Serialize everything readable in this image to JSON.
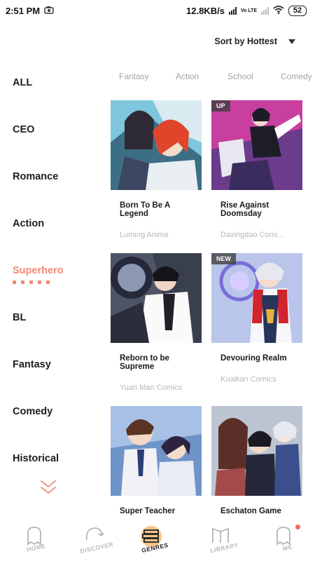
{
  "status_bar": {
    "time": "2:51 PM",
    "speed": "12.8KB/s",
    "network_tag": "Vo LTE",
    "battery": "52"
  },
  "sort": {
    "label": "Sort by Hottest",
    "icon": "dropdown-triangle-icon"
  },
  "genres": [
    {
      "label": "ALL"
    },
    {
      "label": "CEO"
    },
    {
      "label": "Romance"
    },
    {
      "label": "Action"
    },
    {
      "label": "Superhero"
    },
    {
      "label": "BL"
    },
    {
      "label": "Fantasy"
    },
    {
      "label": "Comedy"
    },
    {
      "label": "Historical"
    }
  ],
  "active_genre": "Superhero",
  "subgenre_tabs": [
    "Fantasy",
    "Action",
    "School",
    "Comedy"
  ],
  "comics": [
    {
      "title": "Born To Be A Legend",
      "author": "Luming Anime",
      "tag": ""
    },
    {
      "title": "Rise Against Doomsday",
      "author": "Daxingdao Comi...",
      "tag": "UP"
    },
    {
      "title": "Reborn to be Supreme",
      "author": "Yuan Man Comics",
      "tag": ""
    },
    {
      "title": "Devouring Realm",
      "author": "Kuaikan Comics",
      "tag": "NEW"
    },
    {
      "title": "Super Teacher",
      "author": "",
      "tag": ""
    },
    {
      "title": "Eschaton Game",
      "author": "",
      "tag": ""
    }
  ],
  "bottom_nav": [
    {
      "label": "HOME",
      "icon": "home-ghost-icon",
      "active": false
    },
    {
      "label": "DISCOVER",
      "icon": "discover-icon",
      "active": false
    },
    {
      "label": "GENRES",
      "icon": "genres-stack-icon",
      "active": true
    },
    {
      "label": "LIBRARY",
      "icon": "library-icon",
      "active": false
    },
    {
      "label": "ME",
      "icon": "me-ghost-icon",
      "active": false,
      "has_notification": true
    }
  ],
  "colors": {
    "accent": "#ef8a75",
    "nav_active_bg": "#f6c58a",
    "inactive_text": "#a4a4a4",
    "notification": "#ef6a5a"
  }
}
